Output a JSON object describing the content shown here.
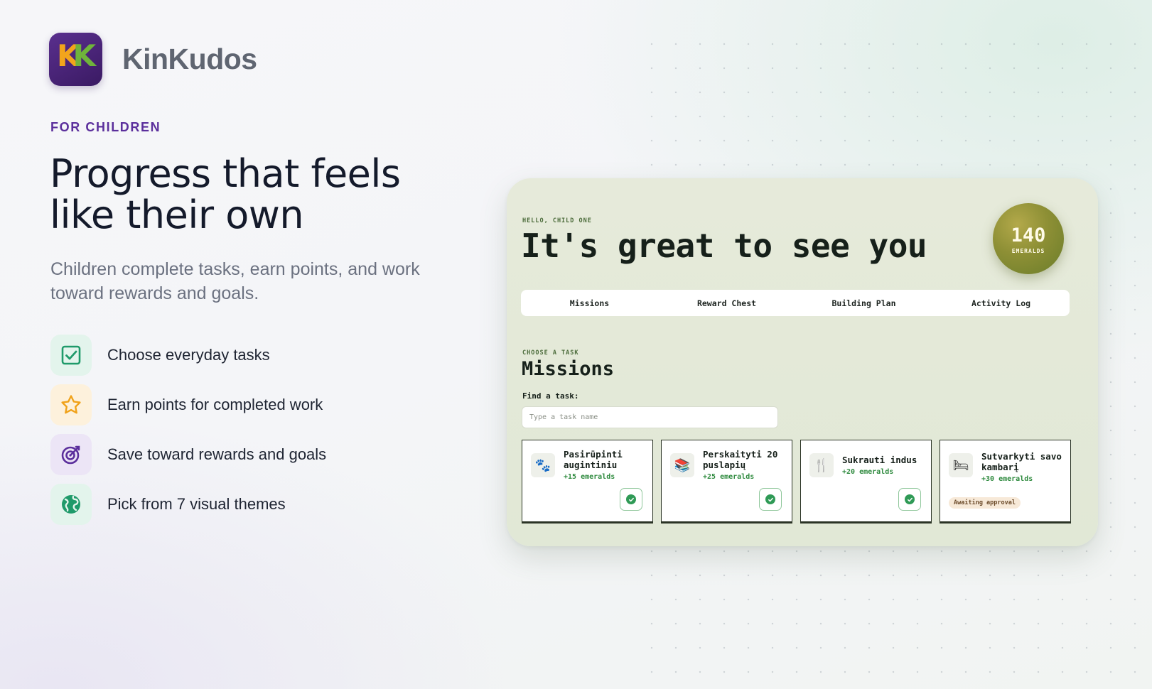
{
  "brand": {
    "logo_text_1": "K",
    "logo_text_2": "K",
    "name": "KinKudos"
  },
  "hero": {
    "eyebrow": "FOR CHILDREN",
    "headline_line1": "Progress that feels",
    "headline_line2": "like their own",
    "subhead": "Children complete tasks, earn points, and work toward rewards and goals."
  },
  "features": [
    {
      "icon": "checkbox-icon",
      "label": "Choose everyday tasks",
      "color": "#1f9a6a",
      "bg": "#e3f4ec"
    },
    {
      "icon": "star-icon",
      "label": "Earn points for completed work",
      "color": "#f0a21a",
      "bg": "#fdf1dc"
    },
    {
      "icon": "target-icon",
      "label": "Save toward rewards and goals",
      "color": "#5b2f9c",
      "bg": "#ece5f6"
    },
    {
      "icon": "globe-icon",
      "label": "Pick from 7 visual themes",
      "color": "#1f9a6a",
      "bg": "#e3f4ec"
    }
  ],
  "preview": {
    "greeting_eyebrow": "HELLO, CHILD ONE",
    "greeting": "It's great to see you",
    "points": {
      "value": "140",
      "label": "EMERALDS"
    },
    "tabs": [
      "Missions",
      "Reward Chest",
      "Building Plan",
      "Activity Log"
    ],
    "section_eyebrow": "CHOOSE A TASK",
    "section_title": "Missions",
    "search": {
      "label": "Find a task:",
      "placeholder": "Type a task name",
      "value": ""
    },
    "tasks": [
      {
        "icon": "paw-icon",
        "glyph": "🐾",
        "name": "Pasirūpinti augintiniu",
        "points": "+15 emeralds",
        "status": "check"
      },
      {
        "icon": "books-icon",
        "glyph": "📚",
        "name": "Perskaityti 20 puslapių",
        "points": "+25 emeralds",
        "status": "check"
      },
      {
        "icon": "fork-knife-icon",
        "glyph": "🍴",
        "name": "Sukrauti indus",
        "points": "+20 emeralds",
        "status": "check"
      },
      {
        "icon": "bed-icon",
        "glyph": "🛏",
        "name": "Sutvarkyti savo kambarį",
        "points": "+30 emeralds",
        "status": "Awaiting approval"
      }
    ],
    "colors": {
      "accent_green": "#2f9a56",
      "card_bg": "#e3e9d8",
      "badge_gold": "#8d8f35"
    }
  }
}
